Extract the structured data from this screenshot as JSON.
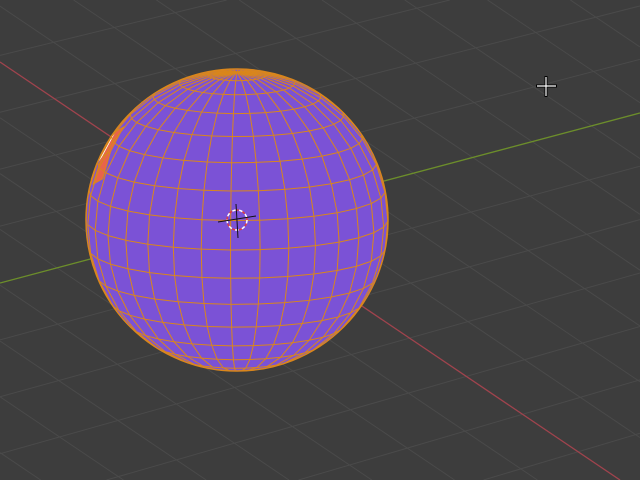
{
  "viewport": {
    "mode": "edit-mode",
    "object": "uv-sphere",
    "sphere": {
      "segments": 32,
      "rings": 16
    },
    "selected_faces": 3,
    "colors": {
      "background": "#3d3d3d",
      "grid": "#4a4a4a",
      "x_axis": "#a0434d",
      "y_axis": "#6c8e2a",
      "face": "#7b52d6",
      "wire": "#d9861c",
      "selected_face": "#e8644a",
      "active_face": "#ec7a68"
    },
    "icons": [
      "3d-cursor-icon",
      "crosshair-cursor-icon"
    ]
  }
}
